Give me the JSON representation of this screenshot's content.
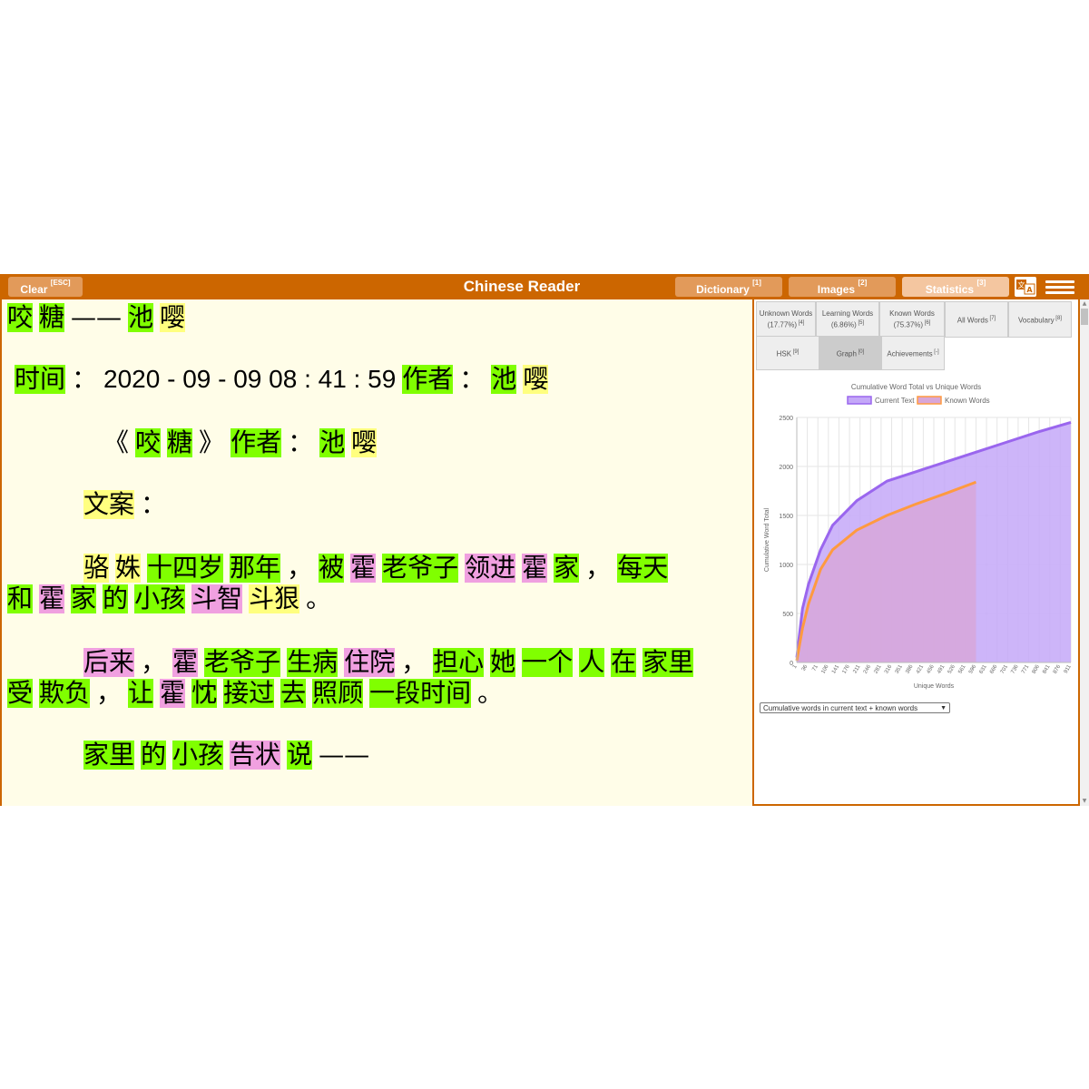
{
  "topbar": {
    "clear_label": "Clear",
    "clear_key": "[ESC]",
    "title": "Chinese Reader",
    "dictionary_label": "Dictionary",
    "dictionary_key": "[1]",
    "images_label": "Images",
    "images_key": "[2]",
    "statistics_label": "Statistics",
    "statistics_key": "[3]"
  },
  "reader": {
    "lines": [
      {
        "top": 4,
        "left": 6,
        "tokens": [
          [
            "咬",
            "g"
          ],
          [
            "糖",
            "g"
          ],
          [
            "——",
            ""
          ],
          [
            "池",
            "g"
          ],
          [
            "嘤",
            "y"
          ]
        ]
      },
      {
        "top": 72,
        "left": 14,
        "tokens": [
          [
            "时间",
            "g"
          ],
          [
            "：",
            ""
          ],
          [
            "2020 - 09 - 09 08 : 41 : 59",
            "n"
          ],
          [
            "作者",
            "g"
          ],
          [
            "：",
            ""
          ],
          [
            "池",
            "g"
          ],
          [
            "嘤",
            "y"
          ]
        ]
      },
      {
        "top": 142,
        "left": 112,
        "tokens": [
          [
            "《",
            ""
          ],
          [
            "咬",
            "g"
          ],
          [
            "糖",
            "g"
          ],
          [
            "》",
            ""
          ],
          [
            "作者",
            "g"
          ],
          [
            "：",
            ""
          ],
          [
            "池",
            "g"
          ],
          [
            "嘤",
            "y"
          ]
        ]
      },
      {
        "top": 210,
        "left": 90,
        "tokens": [
          [
            "文案",
            "y"
          ],
          [
            "：",
            ""
          ]
        ]
      },
      {
        "top": 280,
        "left": 90,
        "tokens": [
          [
            "骆",
            "y"
          ],
          [
            "姝",
            "y"
          ],
          [
            "十四岁",
            "g"
          ],
          [
            "那年",
            "g"
          ],
          [
            "，",
            ""
          ],
          [
            "被",
            "g"
          ],
          [
            "霍",
            "p"
          ],
          [
            "老爷子",
            "g"
          ],
          [
            "领进",
            "p"
          ],
          [
            "霍",
            "p"
          ],
          [
            "家",
            "g"
          ],
          [
            "，",
            ""
          ],
          [
            "每天",
            "g"
          ]
        ]
      },
      {
        "top": 314,
        "left": 6,
        "tokens": [
          [
            "和",
            "g"
          ],
          [
            "霍",
            "p"
          ],
          [
            "家",
            "g"
          ],
          [
            "的",
            "g"
          ],
          [
            "小孩",
            "g"
          ],
          [
            "斗智",
            "p"
          ],
          [
            "斗狠",
            "y"
          ],
          [
            "。",
            ""
          ]
        ]
      },
      {
        "top": 384,
        "left": 90,
        "tokens": [
          [
            "后来",
            "p"
          ],
          [
            "，",
            ""
          ],
          [
            "霍",
            "p"
          ],
          [
            "老爷子",
            "g"
          ],
          [
            "生病",
            "g"
          ],
          [
            "住院",
            "p"
          ],
          [
            "，",
            ""
          ],
          [
            "担心",
            "g"
          ],
          [
            "她",
            "g"
          ],
          [
            "一个",
            "g"
          ],
          [
            "人",
            "g"
          ],
          [
            "在",
            "g"
          ],
          [
            "家里",
            "g"
          ]
        ]
      },
      {
        "top": 418,
        "left": 6,
        "tokens": [
          [
            "受",
            "g"
          ],
          [
            "欺负",
            "g"
          ],
          [
            "，",
            ""
          ],
          [
            "让",
            "g"
          ],
          [
            "霍",
            "p"
          ],
          [
            "忱",
            "g"
          ],
          [
            "接过",
            "g"
          ],
          [
            "去",
            "g"
          ],
          [
            "照顾",
            "g"
          ],
          [
            "一段时间",
            "g"
          ],
          [
            "。",
            ""
          ]
        ]
      },
      {
        "top": 486,
        "left": 90,
        "tokens": [
          [
            "家里",
            "g"
          ],
          [
            "的",
            "g"
          ],
          [
            "小孩",
            "g"
          ],
          [
            "告状",
            "p"
          ],
          [
            "说",
            "g"
          ],
          [
            "——",
            ""
          ]
        ]
      }
    ]
  },
  "stats": {
    "tabs": [
      {
        "label": "Unknown Words (17.77%)",
        "key": "[4]"
      },
      {
        "label": "Learning Words (6.86%)",
        "key": "[5]"
      },
      {
        "label": "Known Words (75.37%)",
        "key": "[6]"
      },
      {
        "label": "All Words",
        "key": "[7]"
      },
      {
        "label": "Vocabulary",
        "key": "[8]"
      },
      {
        "label": "HSK",
        "key": "[9]"
      },
      {
        "label": "Graph",
        "key": "[0]"
      },
      {
        "label": "Achievements",
        "key": "[-]"
      }
    ],
    "chart_select_value": "Cumulative words in current text + known words"
  },
  "chart_data": {
    "type": "area",
    "title": "Cumulative Word Total vs Unique Words",
    "xlabel": "Unique Words",
    "ylabel": "Cumulative Word Total",
    "ylim": [
      0,
      2500
    ],
    "yticks": [
      "0",
      "500",
      "1000",
      "1500",
      "2000",
      "2500"
    ],
    "xticks": [
      "1",
      "36",
      "71",
      "106",
      "141",
      "176",
      "211",
      "246",
      "281",
      "316",
      "351",
      "386",
      "421",
      "456",
      "491",
      "526",
      "561",
      "596",
      "631",
      "666",
      "701",
      "736",
      "771",
      "806",
      "841",
      "876",
      "911"
    ],
    "grid": true,
    "legend_position": "top",
    "series": [
      {
        "name": "Current Text",
        "color": "#9a66ee",
        "fill": "#c4a8f8",
        "x": [
          1,
          20,
          40,
          80,
          120,
          200,
          300,
          400,
          500,
          600,
          700,
          800,
          911
        ],
        "values": [
          50,
          550,
          800,
          1150,
          1400,
          1650,
          1850,
          1950,
          2050,
          2150,
          2250,
          2350,
          2450
        ]
      },
      {
        "name": "Known Words",
        "color": "#ff9a40",
        "fill": "#d8a6d8",
        "x": [
          1,
          20,
          40,
          80,
          120,
          200,
          300,
          400,
          500,
          596
        ],
        "values": [
          20,
          350,
          600,
          950,
          1150,
          1350,
          1500,
          1620,
          1730,
          1840
        ]
      }
    ]
  }
}
